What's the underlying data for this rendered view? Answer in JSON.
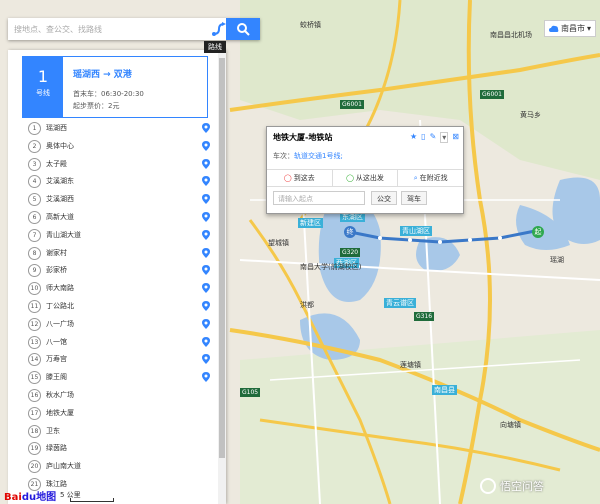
{
  "search": {
    "placeholder": "搜地点、查公交、找路线",
    "route_tooltip": "路线"
  },
  "city_selector": {
    "label": "南昌市"
  },
  "line": {
    "number": "1",
    "type": "号线",
    "title": "瑶湖西 → 双港",
    "first_last": "首末车：06:30-20:30",
    "fare": "起步票价：2元"
  },
  "stops": [
    {
      "num": "1",
      "name": "瑶湖西"
    },
    {
      "num": "2",
      "name": "奥体中心"
    },
    {
      "num": "3",
      "name": "太子殿"
    },
    {
      "num": "4",
      "name": "艾溪湖东"
    },
    {
      "num": "5",
      "name": "艾溪湖西"
    },
    {
      "num": "6",
      "name": "高新大道"
    },
    {
      "num": "7",
      "name": "青山湖大道"
    },
    {
      "num": "8",
      "name": "谢家村"
    },
    {
      "num": "9",
      "name": "彭家桥"
    },
    {
      "num": "10",
      "name": "师大南路"
    },
    {
      "num": "11",
      "name": "丁公路北"
    },
    {
      "num": "12",
      "name": "八一广场"
    },
    {
      "num": "13",
      "name": "八一馆"
    },
    {
      "num": "14",
      "name": "万寿宫"
    },
    {
      "num": "15",
      "name": "滕王阁"
    },
    {
      "num": "16",
      "name": "秋水广场"
    },
    {
      "num": "17",
      "name": "地铁大厦"
    },
    {
      "num": "18",
      "name": "卫东"
    },
    {
      "num": "19",
      "name": "绿茵路"
    },
    {
      "num": "20",
      "name": "庐山南大道"
    },
    {
      "num": "21",
      "name": "珠江路"
    }
  ],
  "popup": {
    "title": "地铁大厦-地铁站",
    "line_label": "车次：",
    "line_link": "轨道交通1号线;",
    "tabs": [
      "到这去",
      "从这出发",
      "在附近找"
    ],
    "input_placeholder": "请输入起点",
    "btn_bus": "公交",
    "btn_drive": "驾车"
  },
  "map": {
    "scale_label": "5 公里",
    "logo_bai": "Bai",
    "logo_du": "du地图",
    "watermark": "悟空问答",
    "labels": {
      "huangma": "黄马乡",
      "nanchang_county": "南昌县",
      "xiangtang": "向塘镇",
      "jiaoqiao": "蛟桥镇",
      "changbei": "昌北",
      "qingshan_lake": "青山湖区",
      "donghu": "东湖区",
      "xihu": "西湖区",
      "qingyunpu": "青云谱区",
      "xinjian": "新建区",
      "nanchang_univ": "南昌大学(前湖校区)",
      "wanghu": "望城镇",
      "lianguo": "莲塘镇",
      "hongdu": "洪都",
      "airport": "南昌昌北机场",
      "yaohu": "瑶湖",
      "start_marker": "起",
      "end_marker": "终"
    },
    "shields": {
      "g6001a": "G6001",
      "g6001b": "G6001",
      "g320": "G320",
      "g316": "G316",
      "g105": "G105"
    },
    "colors": {
      "water": "#a8c8e8",
      "route": "#3a78c8",
      "highway": "#f5c84a",
      "land": "#ede9df",
      "park": "#c9dfb0",
      "accent": "#3385ff"
    }
  }
}
